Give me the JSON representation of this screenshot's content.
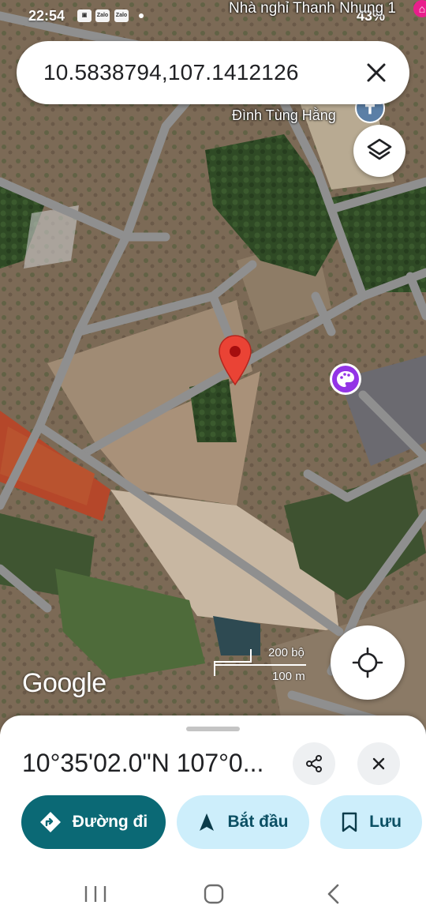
{
  "status_bar": {
    "time": "22:54",
    "notification_icons": [
      "gallery-icon",
      "zalo-icon",
      "zalo-icon",
      "dot-icon"
    ],
    "zalo_label": "Zalo",
    "battery": "43%"
  },
  "map": {
    "labels": {
      "top_place": "Nhà nghỉ Thanh Nhung 1",
      "temple": "Đình Tùng Hằng"
    },
    "logo": "Google",
    "scale": {
      "imperial": "200 bộ",
      "metric": "100 m"
    },
    "colors": {
      "pin": "#ea4335",
      "road": "#8f8f8f",
      "poi_art": "#9334e6"
    }
  },
  "search": {
    "value": "10.5838794,107.1412126",
    "clear_icon": "close-icon"
  },
  "sheet": {
    "title": "10°35'02.0\"N 107°0...",
    "actions": [
      {
        "label": "Đường đi",
        "icon": "directions-icon"
      },
      {
        "label": "Bắt đầu",
        "icon": "navigation-arrow-icon"
      },
      {
        "label": "Lưu",
        "icon": "bookmark-icon"
      }
    ],
    "colors": {
      "primary": "#0b6975",
      "secondary": "#cdeefb"
    }
  },
  "nav_bar": {
    "buttons": [
      "recent-apps-icon",
      "home-icon",
      "back-icon"
    ]
  }
}
